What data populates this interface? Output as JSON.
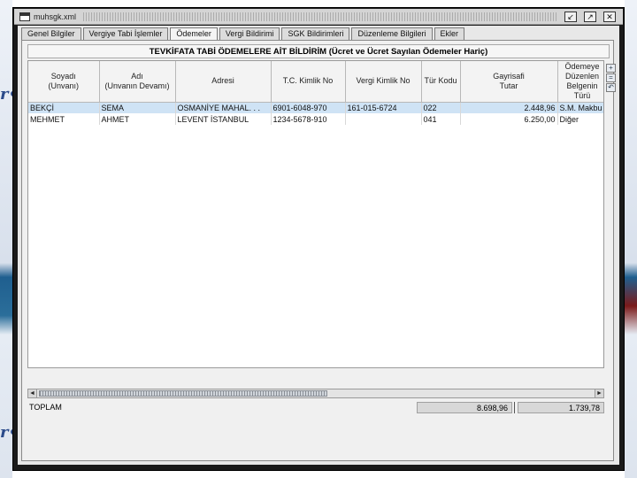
{
  "window": {
    "title": "muhsgk.xml",
    "buttons": {
      "minimize": "↙",
      "maximize": "↗",
      "close": "✕"
    }
  },
  "tabs": [
    {
      "label": "Genel Bilgiler",
      "active": false
    },
    {
      "label": "Vergiye Tabi İşlemler",
      "active": false
    },
    {
      "label": "Ödemeler",
      "active": true
    },
    {
      "label": "Vergi Bildirimi",
      "active": false
    },
    {
      "label": "SGK Bildirimleri",
      "active": false
    },
    {
      "label": "Düzenleme Bilgileri",
      "active": false
    },
    {
      "label": "Ekler",
      "active": false
    }
  ],
  "report": {
    "title": "TEVKİFATA TABİ ÖDEMELERE AİT BİLDİRİM (Ücret ve Ücret Sayılan Ödemeler Hariç)"
  },
  "table": {
    "columns": [
      "Soyadı\n(Unvanı)",
      "Adı\n(Unvanın Devamı)",
      "Adresi",
      "T.C. Kimlik No",
      "Vergi Kimlik No",
      "Tür Kodu",
      "Gayrisafi\nTutar",
      "Ödemeye\nDüzenlen\nBelgenin\nTürü"
    ],
    "rows": [
      {
        "selected": true,
        "cells": [
          "BEKÇİ",
          "SEMA",
          "OSMANİYE MAHAL. . .",
          "6901-6048-970",
          "161-015-6724",
          "022",
          "2.448,96",
          "S.M. Makbu"
        ]
      },
      {
        "selected": false,
        "cells": [
          "MEHMET",
          "AHMET",
          "LEVENT İSTANBUL",
          "1234-5678-910",
          "",
          "041",
          "6.250,00",
          "Diğer"
        ]
      }
    ]
  },
  "side_icons": [
    "+",
    "=",
    "↶"
  ],
  "scroll": {
    "left_arrow": "◄",
    "right_arrow": "►"
  },
  "totals": {
    "label": "TOPLAM",
    "gross": "8.698,96",
    "tax": "1.739,78"
  },
  "background": {
    "mark_top": "r•",
    "mark_bottom": "r•"
  }
}
